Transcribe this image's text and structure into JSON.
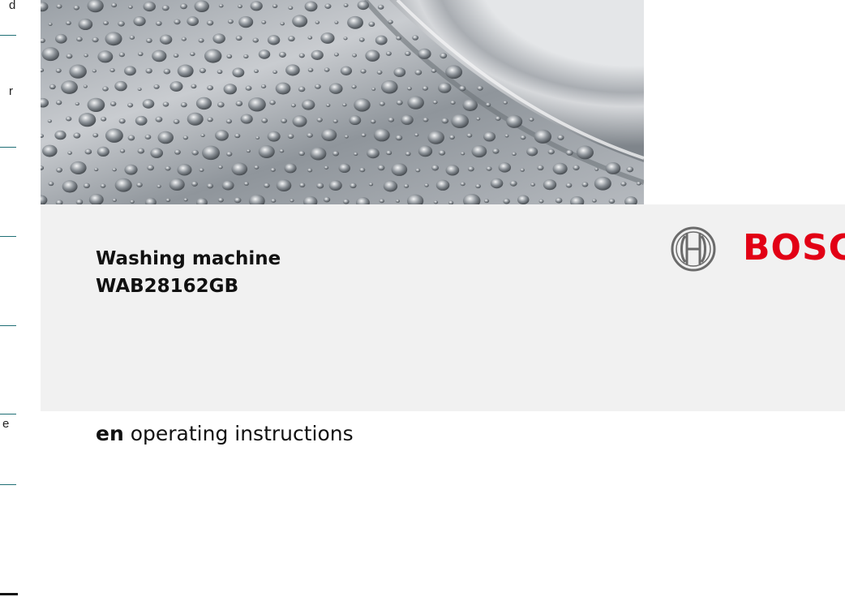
{
  "left_margin": {
    "fragments": [
      "d",
      "r",
      "e"
    ]
  },
  "cover_image": {
    "alt": "perforated stainless steel washing drum"
  },
  "product": {
    "title_line1": "Washing machine",
    "title_line2": "WAB28162GB"
  },
  "brand": {
    "name": "BOSC",
    "color": "#e20015",
    "icon": "bosch-armature-icon"
  },
  "manual": {
    "lang_code": "en",
    "description": "operating instructions"
  }
}
